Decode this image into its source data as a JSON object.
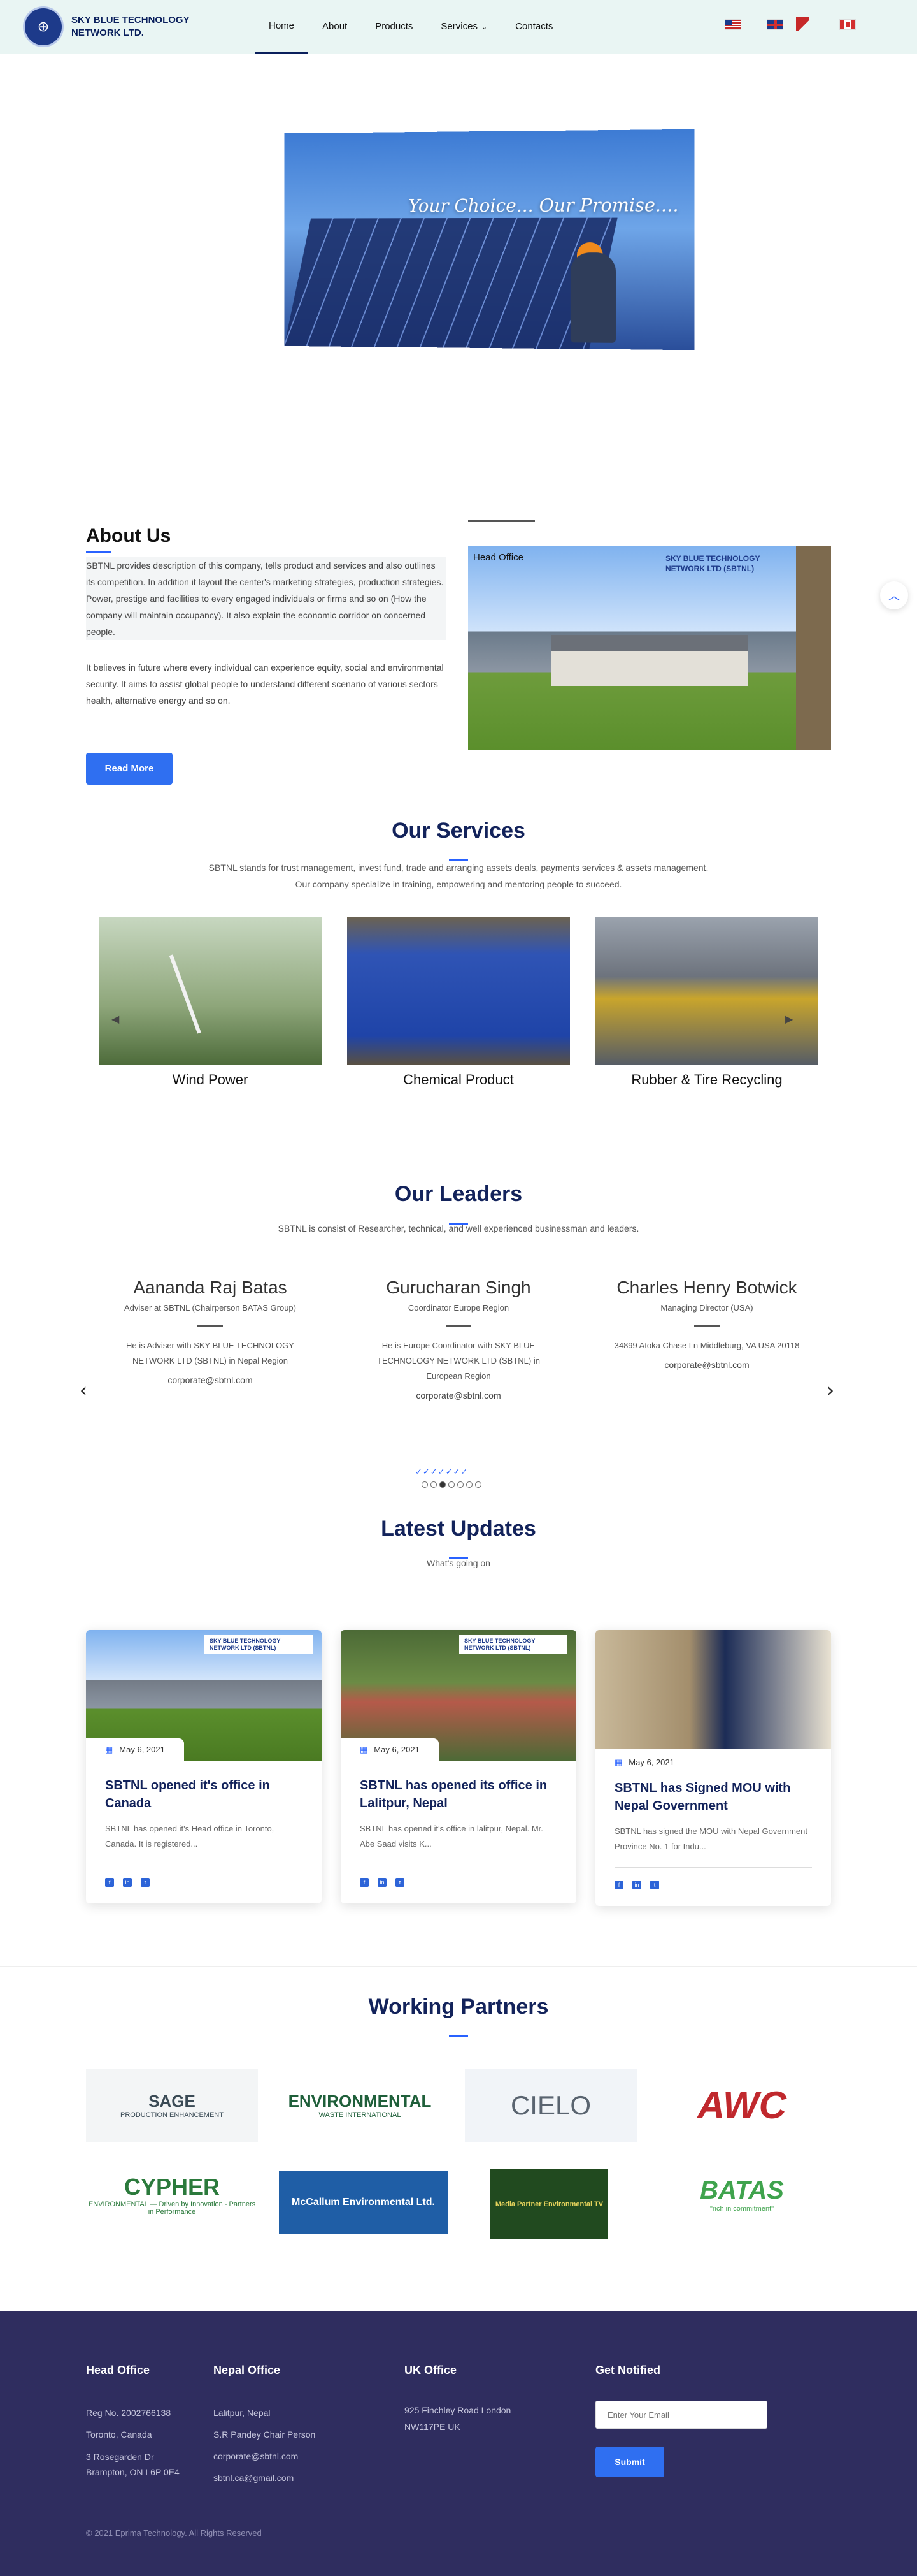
{
  "nav": {
    "logo_text": "SKY BLUE TECHNOLOGY NETWORK LTD.",
    "items": [
      "Home",
      "About",
      "Products",
      "Services",
      "Contacts"
    ],
    "active": "Home"
  },
  "hero": {
    "tagline": "Your Choice... Our Promise...."
  },
  "about": {
    "title": "About Us",
    "p1": "SBTNL provides description of this company, tells product and services and also outlines its competition. In addition it layout the center's marketing strategies, production strategies. Power, prestige and facilities to every engaged individuals or firms and so on (How the company will maintain occupancy). It also explain the economic corridor on concerned people.",
    "p2": "It believes in future where every individual can experience equity, social and environmental security. It aims to assist global people to understand different scenario of various sectors health, alternative energy and so on.",
    "button": "Read More",
    "image_label": "Head Office",
    "image_brand": "SKY BLUE TECHNOLOGY NETWORK LTD (SBTNL)"
  },
  "services": {
    "title": "Our Services",
    "subtitle": "SBTNL stands for trust management, invest fund, trade and arranging assets deals, payments services & assets management. Our company specialize in training, empowering and mentoring people to succeed.",
    "items": [
      {
        "name": "Wind Power",
        "image_icon": "wind-turbine-image"
      },
      {
        "name": "Chemical Product",
        "image_icon": "chemical-drums-image"
      },
      {
        "name": "Rubber & Tire Recycling",
        "image_icon": "recycling-plant-image"
      }
    ]
  },
  "leaders": {
    "title": "Our Leaders",
    "subtitle": "SBTNL is consist of Researcher, technical, and well experienced businessman and leaders.",
    "items": [
      {
        "name": "Aananda Raj Batas",
        "role": "Adviser at SBTNL (Chairperson BATAS Group)",
        "desc": "He is Adviser with SKY BLUE TECHNOLOGY NETWORK LTD (SBTNL) in Nepal Region",
        "email": "corporate@sbtnl.com"
      },
      {
        "name": "Gurucharan Singh",
        "role": "Coordinator Europe Region",
        "desc": "He is Europe Coordinator with SKY BLUE TECHNOLOGY NETWORK LTD (SBTNL) in European Region",
        "email": "corporate@sbtnl.com"
      },
      {
        "name": "Charles Henry Botwick",
        "role": "Managing Director (USA)",
        "desc": "34899 Atoka Chase Ln Middleburg, VA USA 20118",
        "email": "corporate@sbtnl.com"
      }
    ],
    "checks": "✓✓✓✓✓✓✓"
  },
  "updates": {
    "title": "Latest Updates",
    "subtitle": "What's going on",
    "cards": [
      {
        "date": "May 6, 2021",
        "title": "SBTNL opened it's office in Canada",
        "excerpt": "SBTNL has opened it's Head office in Toronto, Canada. It is registered...",
        "brand": "SKY BLUE TECHNOLOGY NETWORK LTD (SBTNL)"
      },
      {
        "date": "May 6, 2021",
        "title": "SBTNL has opened its office in Lalitpur, Nepal",
        "excerpt": "SBTNL has opened it's office in lalitpur, Nepal. Mr. Abe Saad visits K...",
        "brand": "SKY BLUE TECHNOLOGY NETWORK LTD (SBTNL)"
      },
      {
        "date": "May 6, 2021",
        "title": "SBTNL has Signed MOU with Nepal Government",
        "excerpt": "SBTNL has signed the MOU with Nepal Government Province No. 1 for Indu..."
      }
    ]
  },
  "partners": {
    "title": "Working Partners",
    "logos": [
      {
        "name": "SAGE",
        "sub": "PRODUCTION ENHANCEMENT"
      },
      {
        "name": "ENVIRONMENTAL",
        "sub": "WASTE INTERNATIONAL"
      },
      {
        "name": "CIELO",
        "sub": ""
      },
      {
        "name": "AWC",
        "sub": ""
      },
      {
        "name": "CYPHER",
        "sub": "ENVIRONMENTAL — Driven by Innovation - Partners in Performance"
      },
      {
        "name": "McCallum Environmental Ltd.",
        "sub": ""
      },
      {
        "name": "Media Partner Environmental TV",
        "sub": ""
      },
      {
        "name": "BATAS",
        "sub": "\"rich in commitment\""
      }
    ]
  },
  "footer": {
    "head_office": {
      "title": "Head Office",
      "lines": [
        "Reg No. 2002766138",
        "Toronto, Canada",
        "3 Rosegarden Dr",
        "Brampton, ON L6P 0E4"
      ]
    },
    "nepal_office": {
      "title": "Nepal Office",
      "lines": [
        "Lalitpur, Nepal",
        "S.R Pandey Chair Person",
        "corporate@sbtnl.com",
        "sbtnl.ca@gmail.com"
      ]
    },
    "uk_office": {
      "title": "UK Office",
      "lines": [
        "925 Finchley Road London",
        "NW117PE UK"
      ]
    },
    "notify": {
      "title": "Get Notified",
      "placeholder": "Enter Your Email",
      "button": "Submit"
    },
    "copyright": "© 2021 Eprima Technology. All Rights Reserved"
  }
}
